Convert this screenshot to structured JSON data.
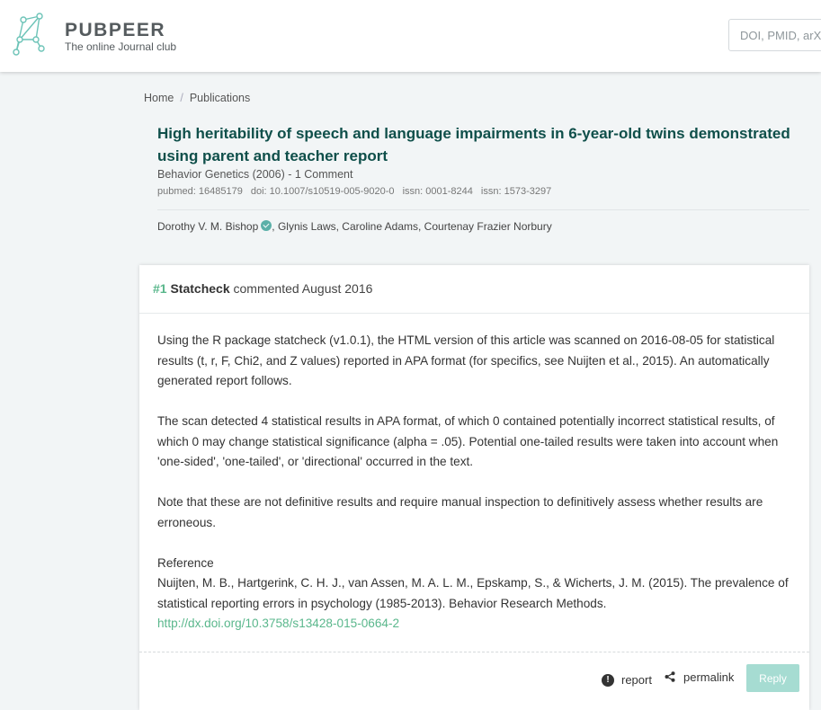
{
  "header": {
    "brand_name": "PUBPEER",
    "tagline": "The online Journal club",
    "search_placeholder": "DOI, PMID, arXiv"
  },
  "breadcrumb": {
    "items": [
      "Home",
      "Publications"
    ],
    "separator": "/"
  },
  "publication": {
    "title": "High heritability of speech and language impairments in 6-year-old twins demonstrated using parent and teacher report",
    "journal_line": "Behavior Genetics (2006) - 1 Comment",
    "ids": [
      "pubmed: 16485179",
      "doi: 10.1007/s10519-005-9020-0",
      "issn: 0001-8244",
      "issn: 1573-3297"
    ],
    "first_author": "Dorothy V. M. Bishop",
    "other_authors": ", Glynis Laws, Caroline Adams, Courtenay Frazier Norbury"
  },
  "comment": {
    "number": "#1",
    "author": "Statcheck",
    "date_text": "commented August 2016",
    "paragraphs": [
      "Using the R package statcheck (v1.0.1), the HTML version of this article was scanned on 2016-08-05 for statistical results (t, r, F, Chi2, and Z values) reported in APA format (for specifics, see Nuijten et al., 2015). An automatically generated report follows.",
      "The scan detected 4 statistical results in APA format, of which 0 contained potentially incorrect statistical results, of which 0 may change statistical significance (alpha = .05). Potential one-tailed results were taken into account when 'one-sided', 'one-tailed', or 'directional' occurred in the text.",
      "Note that these are not definitive results and require manual inspection to definitively assess whether results are erroneous."
    ],
    "reference_heading": "Reference",
    "reference_text": "Nuijten, M. B., Hartgerink, C. H. J., van Assen, M. A. L. M., Epskamp, S., & Wicherts, J. M. (2015). The prevalence of statistical reporting errors in psychology (1985-2013). Behavior Research Methods.",
    "reference_link": "http://dx.doi.org/10.3758/s13428-015-0664-2",
    "report_label": "report",
    "permalink_label": "permalink",
    "reply_label": "Reply"
  },
  "colors": {
    "brand_accent": "#5ab78c",
    "title_color": "#0f4f4a",
    "reply_button": "#a6dcd2"
  },
  "icons": [
    "pubpeer-logo-icon",
    "verified-icon",
    "report-icon",
    "share-icon"
  ]
}
